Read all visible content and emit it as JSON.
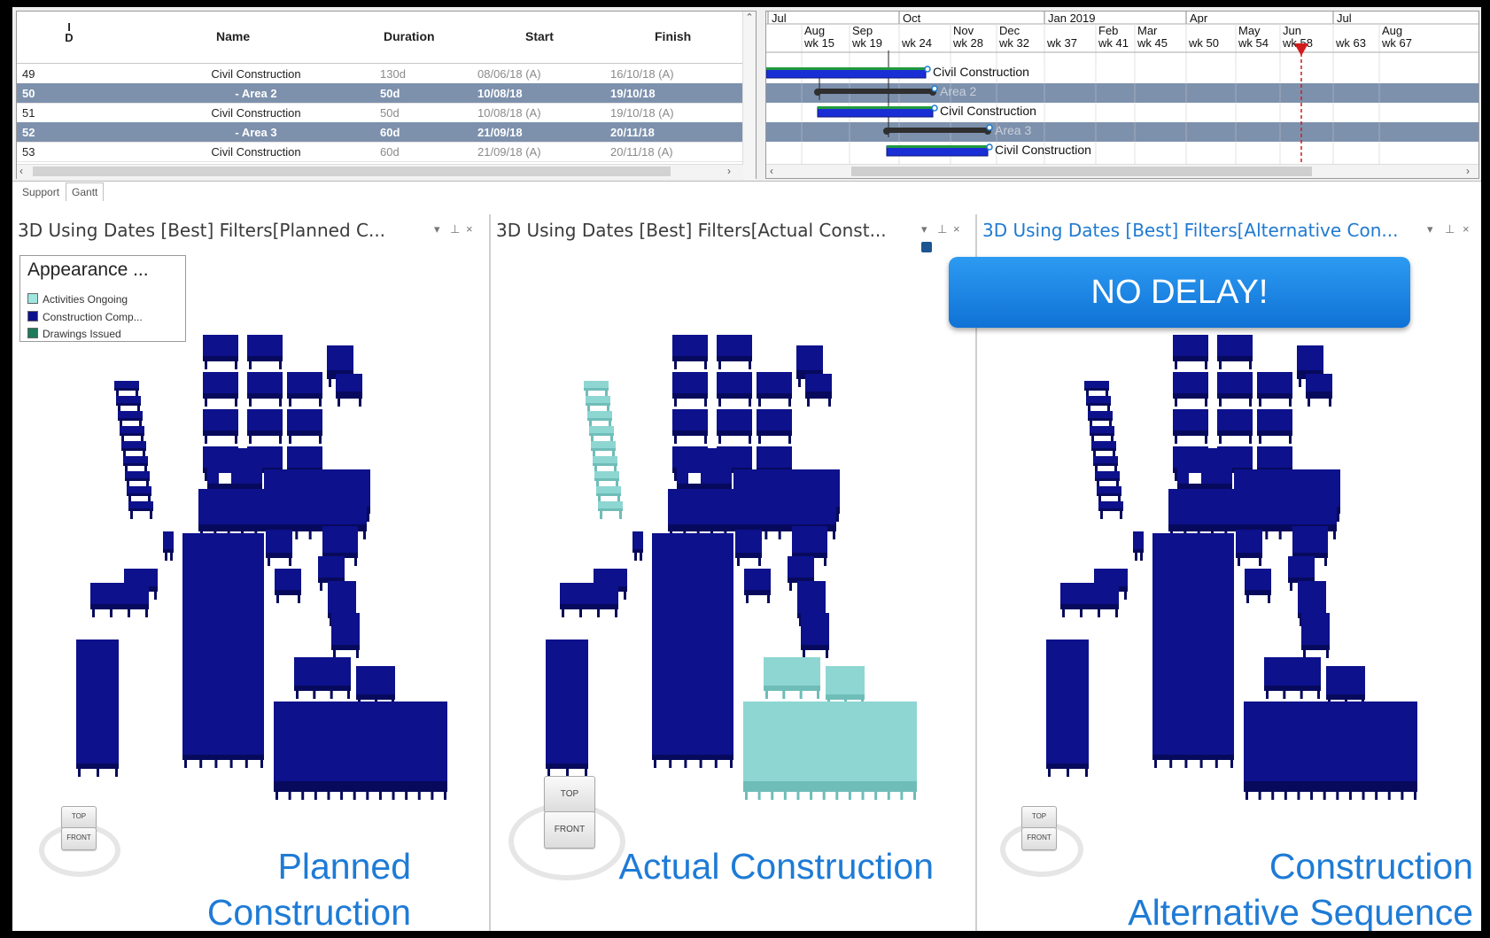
{
  "gantt": {
    "columns": {
      "id": "I\nD",
      "name": "Name",
      "duration": "Duration",
      "start": "Start",
      "finish": "Finish"
    },
    "rows": [
      {
        "id": "49",
        "name": "Civil Construction",
        "duration": "130d",
        "start": "08/06/18 (A)",
        "finish": "16/10/18 (A)",
        "selected": false
      },
      {
        "id": "50",
        "name": "- Area 2",
        "duration": "50d",
        "start": "10/08/18",
        "finish": "19/10/18",
        "selected": true
      },
      {
        "id": "51",
        "name": "Civil Construction",
        "duration": "50d",
        "start": "10/08/18 (A)",
        "finish": "19/10/18 (A)",
        "selected": false
      },
      {
        "id": "52",
        "name": "- Area 3",
        "duration": "60d",
        "start": "21/09/18",
        "finish": "20/11/18",
        "selected": true
      },
      {
        "id": "53",
        "name": "Civil Construction",
        "duration": "60d",
        "start": "21/09/18 (A)",
        "finish": "20/11/18 (A)",
        "selected": false
      }
    ],
    "timescale_major": [
      "Jul",
      "Oct",
      "Jan 2019",
      "Apr",
      "Jul"
    ],
    "timescale_months": [
      "Aug",
      "Sep",
      "Nov",
      "Dec",
      "Feb",
      "Mar",
      "May",
      "Jun",
      "Aug"
    ],
    "timescale_weeks": [
      "wk 15",
      "wk 19",
      "wk 24",
      "wk 28",
      "wk 32",
      "wk 37",
      "wk 41",
      "wk 45",
      "wk 50",
      "wk 54",
      "wk 58",
      "wk 63",
      "wk 67"
    ],
    "bar_labels": [
      "Civil Construction",
      "Area 2",
      "Civil Construction",
      "Area 3",
      "Civil Construction"
    ],
    "colors": {
      "bar_blue": "#1a2ed6",
      "bar_green": "#1f9a3e",
      "summary": "#2f2f2f",
      "today_line": "#d11c1c",
      "selected_row": "#7d91ad"
    }
  },
  "view_tabs": [
    "Support",
    "Gantt"
  ],
  "panels": [
    {
      "title": "3D Using Dates [Best] Filters[Planned C...",
      "caption_line1": "Planned",
      "caption_line2": "Construction",
      "active": false
    },
    {
      "title": "3D Using Dates [Best] Filters[Actual Const...",
      "caption_line1": "",
      "caption_line2": "Actual Construction",
      "active": false
    },
    {
      "title": "3D Using Dates [Best] Filters[Alternative Con...",
      "caption_line1": "Construction",
      "caption_line2": "Alternative Sequence",
      "active": true
    }
  ],
  "panel_controls": {
    "dropdown": "▾",
    "pin": "⊥",
    "close": "×"
  },
  "legend": {
    "title": "Appearance ...",
    "items": [
      {
        "label": "Activities Ongoing",
        "color": "#9fe6e0"
      },
      {
        "label": "Construction Comp...",
        "color": "#0d118c"
      },
      {
        "label": "Drawings Issued",
        "color": "#1c7a5a"
      }
    ]
  },
  "nav_cube": {
    "top": "TOP",
    "front": "FRONT"
  },
  "banner": "NO DELAY!",
  "model_colors": {
    "complete": "#0d118c",
    "ongoing": "#8ed6d2"
  }
}
